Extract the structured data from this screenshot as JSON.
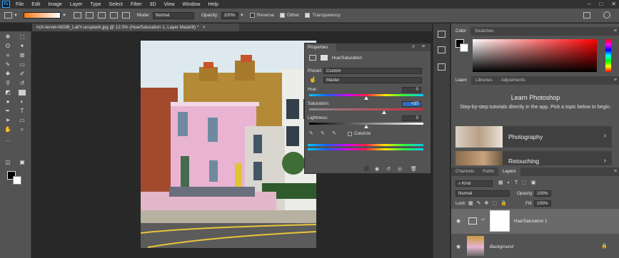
{
  "app": {
    "logo": "Ps"
  },
  "menu": [
    "File",
    "Edit",
    "Image",
    "Layer",
    "Type",
    "Select",
    "Filter",
    "3D",
    "View",
    "Window",
    "Help"
  ],
  "options_bar": {
    "mode_label": "Mode:",
    "mode_value": "Normal",
    "opacity_label": "Opacity:",
    "opacity_value": "100%",
    "reverse_label": "Reverse",
    "dither_label": "Dither",
    "transparency_label": "Transparency",
    "reverse_checked": false,
    "dither_checked": true,
    "transparency_checked": true
  },
  "document": {
    "tab_title": "rich-tervet-NiGlB_LallY-unsplash.jpg @ 12.5% (Hue/Saturation 1, Layer Mask/8) *",
    "tab_close": "×"
  },
  "properties": {
    "tab": "Properties",
    "adjustment_name": "Hue/Saturation",
    "preset_label": "Preset:",
    "preset_value": "Custom",
    "channel_value": "Master",
    "hue_label": "Hue:",
    "hue_value": "0",
    "saturation_label": "Saturation:",
    "saturation_value": "+37",
    "lightness_label": "Lightness:",
    "lightness_value": "0",
    "colorize_label": "Colorize",
    "colorize_checked": false
  },
  "color_panel": {
    "tabs": [
      "Color",
      "Swatches"
    ]
  },
  "learn_panel": {
    "tabs": [
      "Learn",
      "Libraries",
      "Adjustments"
    ],
    "title": "Learn Photoshop",
    "description": "Step-by-step tutorials directly in the app. Pick a topic below to begin.",
    "cards": [
      {
        "label": "Photography"
      },
      {
        "label": "Retouching"
      }
    ]
  },
  "layers_panel": {
    "tabs": [
      "Channels",
      "Paths",
      "Layers"
    ],
    "kind_value": "Kind",
    "blend_value": "Normal",
    "opacity_label": "Opacity:",
    "opacity_value": "100%",
    "lock_label": "Lock:",
    "fill_label": "Fill:",
    "fill_value": "100%",
    "layers": [
      {
        "name": "Hue/Saturation 1",
        "selected": true
      },
      {
        "name": "Background",
        "selected": false
      }
    ]
  },
  "colors": {
    "accent_blue": "#31a8ff",
    "ui_panel": "#535353",
    "ui_dark": "#282828",
    "foreground_color": "#000000",
    "background_color": "#ffffff"
  }
}
